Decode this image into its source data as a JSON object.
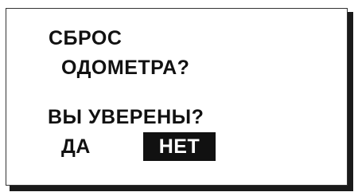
{
  "dialog": {
    "line1": "СБРОС",
    "line2": "ОДОМЕТРА?",
    "question": "ВЫ УВЕРЕНЫ?",
    "option_yes": "ДА",
    "option_no": "НЕТ",
    "selected_option": "НЕТ"
  }
}
